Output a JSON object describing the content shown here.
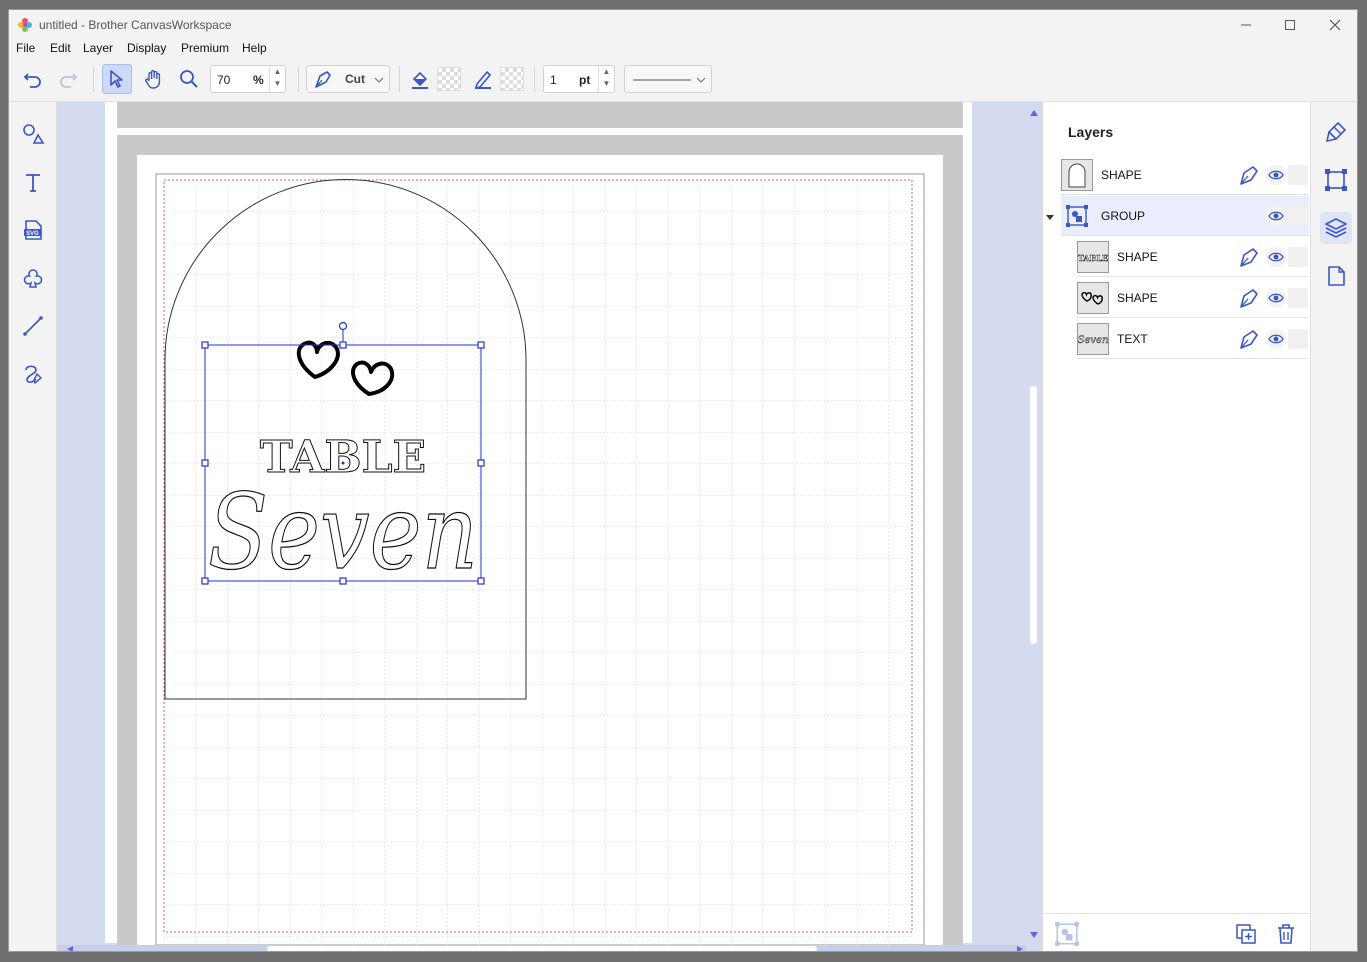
{
  "window": {
    "title": "untitled - Brother CanvasWorkspace"
  },
  "menu": [
    "File",
    "Edit",
    "Layer",
    "Display",
    "Premium",
    "Help"
  ],
  "toolbar": {
    "zoom_value": "70",
    "zoom_unit": "%",
    "mode_label": "Cut",
    "line_width_value": "1",
    "line_width_unit": "pt"
  },
  "design": {
    "top_text": "TABLE",
    "main_text": "Seven"
  },
  "layers": {
    "title": "Layers",
    "items": [
      {
        "name": "SHAPE",
        "thumb": "arch",
        "level": 0,
        "selected": false
      },
      {
        "name": "GROUP",
        "thumb": "group",
        "level": 0,
        "selected": true
      },
      {
        "name": "SHAPE",
        "thumb": "TABLE",
        "level": 1,
        "selected": false
      },
      {
        "name": "SHAPE",
        "thumb": "hearts",
        "level": 1,
        "selected": false
      },
      {
        "name": "TEXT",
        "thumb": "Seven",
        "level": 1,
        "selected": false
      }
    ]
  },
  "colors": {
    "accent": "#3b57c4",
    "selection": "#2233cc",
    "canvas_bg": "#d4daef"
  }
}
